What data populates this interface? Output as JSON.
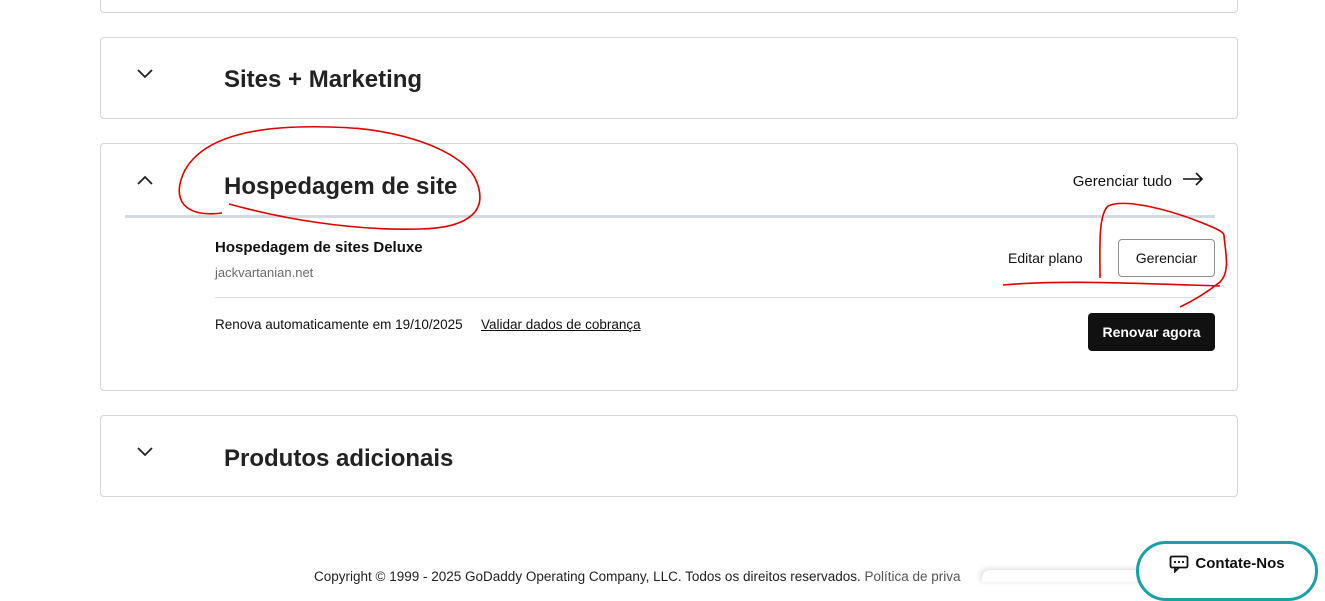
{
  "sections": {
    "sites_marketing": {
      "title": "Sites + Marketing",
      "chevron_icon": "chevron-down-icon"
    },
    "hosting": {
      "title": "Hospedagem de site",
      "chevron_icon": "chevron-up-icon",
      "manage_all_label": "Gerenciar tudo",
      "manage_all_icon": "arrow-right-icon",
      "product_name": "Hospedagem de sites Deluxe",
      "product_domain": "jackvartanian.net",
      "edit_plan_label": "Editar plano",
      "manage_label": "Gerenciar",
      "renew_text": "Renova automaticamente em 19/10/2025",
      "validate_link": "Validar dados de cobrança",
      "renew_now_label": "Renovar agora"
    },
    "additional": {
      "title": "Produtos adicionais",
      "chevron_icon": "chevron-down-icon"
    }
  },
  "footer": {
    "copyright": "Copyright © 1999 - 2025 GoDaddy Operating Company, LLC. Todos os direitos reservados.",
    "privacy_partial": "Política de priva"
  },
  "contact": {
    "label": "Contate-Nos",
    "icon": "chat-icon"
  },
  "colors": {
    "annotation": "#e00000",
    "contact_border": "#1aa1a6",
    "primary_button": "#111111"
  }
}
